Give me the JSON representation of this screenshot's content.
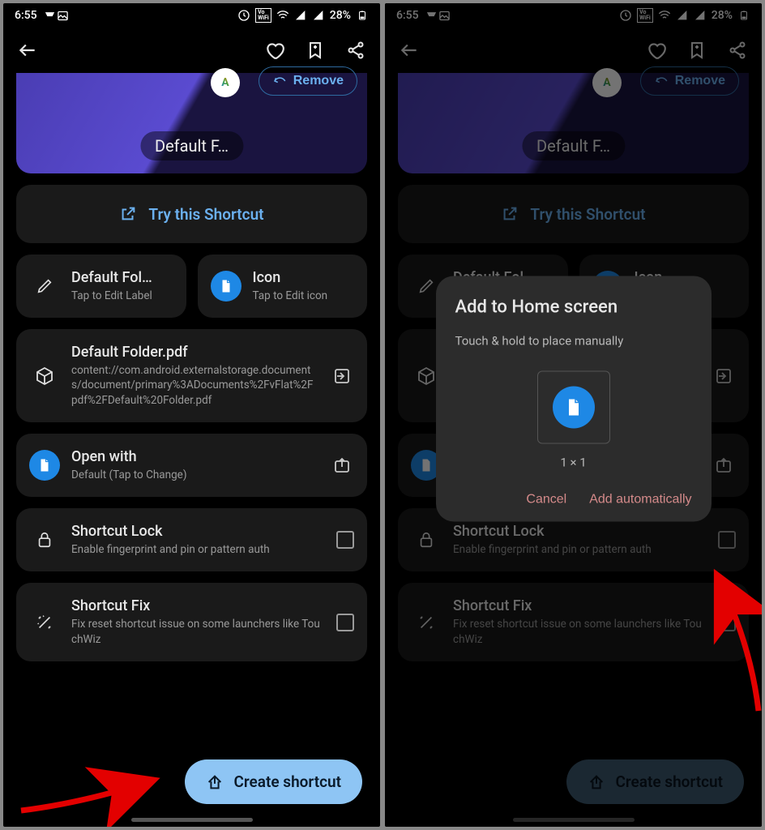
{
  "status": {
    "time": "6:55",
    "battery": "28%"
  },
  "hero": {
    "chip": "Default F…",
    "remove": "Remove"
  },
  "try_label": "Try this Shortcut",
  "cards": {
    "label": {
      "title": "Default Fol…",
      "sub": "Tap to Edit Label"
    },
    "icon": {
      "title": "Icon",
      "sub": "Tap to Edit icon"
    },
    "file": {
      "title": "Default Folder.pdf",
      "sub": "content://com.android.externalstorage.documents/document/primary%3ADocuments%2FvFlat%2Fpdf%2FDefault%20Folder.pdf"
    },
    "open": {
      "title": "Open with",
      "sub": "Default (Tap to Change)"
    },
    "lock": {
      "title": "Shortcut Lock",
      "sub": "Enable fingerprint and pin or pattern auth"
    },
    "fix": {
      "title": "Shortcut Fix",
      "sub": "Fix reset shortcut issue on some launchers like TouchWiz"
    }
  },
  "fab": "Create shortcut",
  "dialog": {
    "title": "Add to Home screen",
    "hint": "Touch & hold to place manually",
    "size": "1 × 1",
    "cancel": "Cancel",
    "add": "Add automatically"
  }
}
